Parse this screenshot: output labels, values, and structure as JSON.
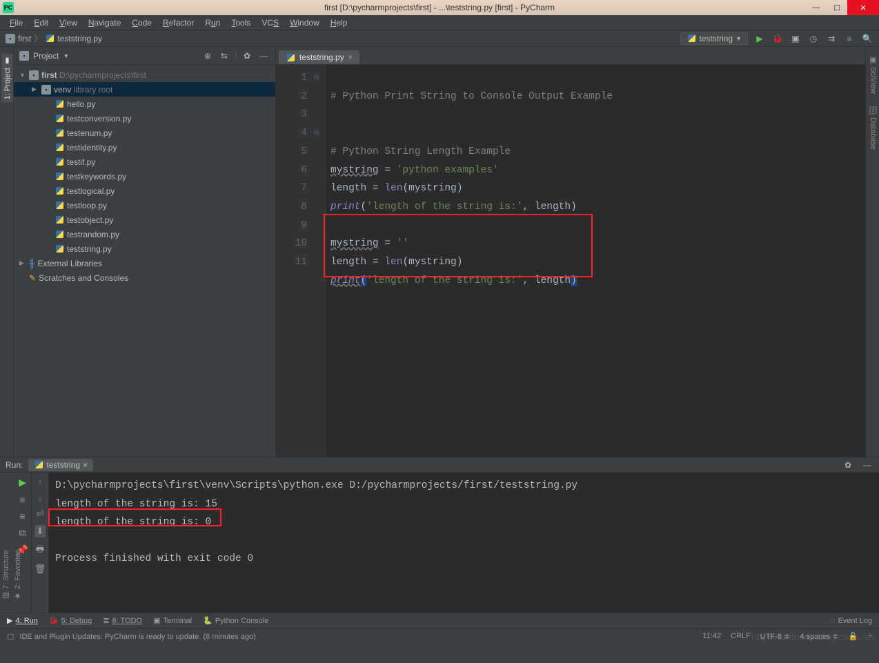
{
  "titlebar": {
    "logo": "PC",
    "title": "first [D:\\pycharmprojects\\first] - ...\\teststring.py [first] - PyCharm"
  },
  "menu": [
    "File",
    "Edit",
    "View",
    "Navigate",
    "Code",
    "Refactor",
    "Run",
    "Tools",
    "VCS",
    "Window",
    "Help"
  ],
  "breadcrumb": {
    "first": "first",
    "file": "teststring.py"
  },
  "runConfig": "teststring",
  "projectHeader": "Project",
  "tree": {
    "root": "first",
    "rootPath": "D:\\pycharmprojects\\first",
    "venv": "venv",
    "venvHint": "library root",
    "files": [
      "hello.py",
      "testconversion.py",
      "testenum.py",
      "testidentity.py",
      "testif.py",
      "testkeywords.py",
      "testlogical.py",
      "testloop.py",
      "testobject.py",
      "testrandom.py",
      "teststring.py"
    ],
    "ext": "External Libraries",
    "scratch": "Scratches and Consoles"
  },
  "editorTab": "teststring.py",
  "lineNums": [
    "1",
    "2",
    "3",
    "4",
    "5",
    "6",
    "7",
    "8",
    "9",
    "10",
    "11"
  ],
  "code": {
    "l1c": "# Python Print String to Console Output Example",
    "l4c": "# Python String Length Example",
    "l5a": "mystring",
    "l5b": " = ",
    "l5c": "'python examples'",
    "l6a": "length = ",
    "l6b": "len",
    "l6c": "(mystring)",
    "l7a": "print",
    "l7b": "(",
    "l7c": "'length of the string is:'",
    "l7d": ", length)",
    "l9a": "mystring",
    "l9b": " = ",
    "l9c": "''",
    "l10a": "length = ",
    "l10b": "len",
    "l10c": "(mystring)",
    "l11a": "print",
    "l11b": "(",
    "l11c": "'length of the string is:'",
    "l11d": ", length",
    "l11e": ")"
  },
  "run": {
    "label": "Run:",
    "tab": "teststring",
    "out1": "D:\\pycharmprojects\\first\\venv\\Scripts\\python.exe D:/pycharmprojects/first/teststring.py",
    "out2": "length of the string is: 15",
    "out3": "length of the string is: 0",
    "out4": "",
    "out5": "Process finished with exit code 0"
  },
  "sideLeft": {
    "project": "1: Project",
    "structure": "7: Structure",
    "favorites": "2: Favorites"
  },
  "sideRight": {
    "sciview": "SciView",
    "database": "Database"
  },
  "bottomTabs": {
    "run": "4: Run",
    "debug": "5: Debug",
    "todo": "6: TODO",
    "terminal": "Terminal",
    "pyconsole": "Python Console",
    "eventlog": "Event Log"
  },
  "status": {
    "msg": "IDE and Plugin Updates: PyCharm is ready to update. (8 minutes ago)",
    "pos": "11:42",
    "eol": "CRLF",
    "enc": "UTF-8",
    "indent": "4 spaces"
  },
  "watermark": "https://defonds.blog.csdn.net"
}
